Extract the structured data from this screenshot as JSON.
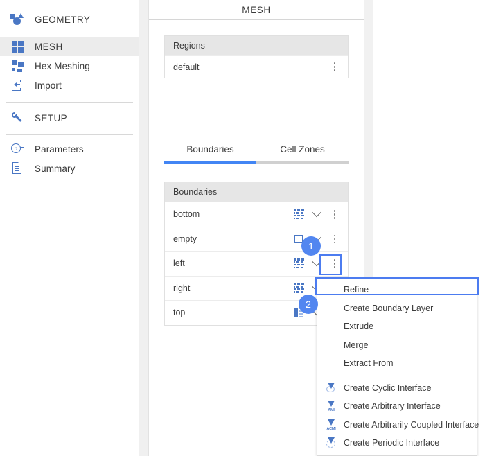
{
  "colors": {
    "accent_blue": "#4285f4",
    "highlight_blue": "#4c7cf0",
    "badge_blue": "#5286f0",
    "icon_blue": "#4a77c4",
    "header_gray": "#e6e6e6",
    "selected_gray": "#ececec"
  },
  "sidebar": {
    "groups": [
      {
        "items": [
          {
            "label": "GEOMETRY",
            "icon": "geometry-icon",
            "selected": false
          }
        ]
      },
      {
        "items": [
          {
            "label": "MESH",
            "icon": "mesh-icon",
            "selected": true
          },
          {
            "label": "Hex Meshing",
            "icon": "hex-meshing-icon",
            "selected": false
          },
          {
            "label": "Import",
            "icon": "import-icon",
            "selected": false
          }
        ]
      },
      {
        "items": [
          {
            "label": "SETUP",
            "icon": "wrench-icon",
            "selected": false
          }
        ]
      },
      {
        "items": [
          {
            "label": "Parameters",
            "icon": "parameters-icon",
            "selected": false
          },
          {
            "label": "Summary",
            "icon": "summary-icon",
            "selected": false
          }
        ]
      }
    ]
  },
  "panel": {
    "title": "MESH",
    "regions": {
      "header": "Regions",
      "rows": [
        {
          "name": "default"
        }
      ]
    },
    "tabs": [
      {
        "label": "Boundaries",
        "active": true
      },
      {
        "label": "Cell Zones",
        "active": false
      }
    ],
    "boundaries": {
      "header": "Boundaries",
      "rows": [
        {
          "name": "bottom",
          "icon": "wall-brick-icon"
        },
        {
          "name": "empty",
          "icon": "empty-square-icon"
        },
        {
          "name": "left",
          "icon": "wall-brick-icon"
        },
        {
          "name": "right",
          "icon": "wall-brick-icon"
        },
        {
          "name": "top",
          "icon": "patch-icon"
        }
      ]
    }
  },
  "context_menu": {
    "items": [
      {
        "label": "Refine",
        "icon": null,
        "highlighted": true
      },
      {
        "label": "Create Boundary Layer",
        "icon": null,
        "highlighted": false
      },
      {
        "label": "Extrude",
        "icon": null,
        "highlighted": false
      },
      {
        "label": "Merge",
        "icon": null,
        "highlighted": false
      },
      {
        "label": "Extract From",
        "icon": null,
        "highlighted": false
      }
    ],
    "items_after_separator": [
      {
        "label": "Create Cyclic Interface",
        "icon": "cyclic-interface-icon",
        "icon_text": ""
      },
      {
        "label": "Create Arbitrary Interface",
        "icon": "ami-interface-icon",
        "icon_text": "AMI"
      },
      {
        "label": "Create Arbitrarily Coupled Interface",
        "icon": "acmi-interface-icon",
        "icon_text": "ACMI"
      },
      {
        "label": "Create Periodic Interface",
        "icon": "periodic-interface-icon",
        "icon_text": ""
      }
    ]
  },
  "annotations": {
    "badges": [
      {
        "number": "1"
      },
      {
        "number": "2"
      }
    ]
  }
}
